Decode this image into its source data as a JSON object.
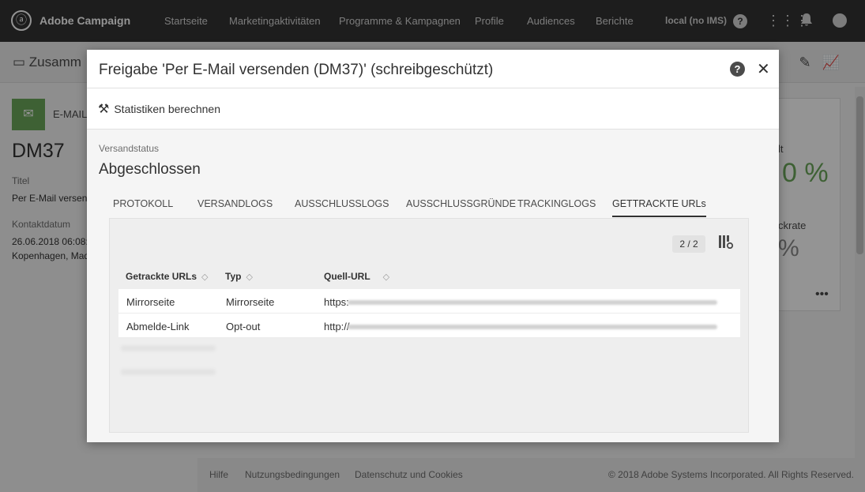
{
  "topbar": {
    "brand": "Adobe Campaign",
    "nav": [
      "Startseite",
      "Marketingaktivitäten",
      "Programme & Kampagnen",
      "Profile",
      "Audiences",
      "Berichte"
    ],
    "instance": "local (no IMS)",
    "help_glyph": "?"
  },
  "background": {
    "page_title": "Zusamm",
    "channel_label": "E-MAIL",
    "delivery_code": "DM37",
    "title_label": "Titel",
    "title_value": "Per E-Mail versend",
    "contact_label": "Kontaktdatum",
    "contact_date": "26.06.2018 06:08:5",
    "contact_place": "Kopenhagen, Mad",
    "card_label_1": "lt",
    "card_pct_1": "0 %",
    "card_label_2": "ckrate",
    "card_pct_2": "%",
    "card_more": "•••",
    "footer_links": [
      "Hilfe",
      "Nutzungsbedingungen",
      "Datenschutz und Cookies"
    ],
    "copyright": "© 2018 Adobe Systems Incorporated. All Rights Reserved."
  },
  "modal": {
    "title": "Freigabe 'Per E-Mail versenden (DM37)' (schreibgeschützt)",
    "help_glyph": "?",
    "close_glyph": "✕",
    "toolbar_action": "Statistiken berechnen",
    "status_label": "Versandstatus",
    "status_value": "Abgeschlossen",
    "tabs": [
      "PROTOKOLL",
      "VERSANDLOGS",
      "AUSSCHLUSSLOGS",
      "AUSSCHLUSSGRÜNDE",
      "TRACKINGLOGS",
      "GETTRACKTE URLs"
    ],
    "active_tab": "GETTRACKTE URLs",
    "pager": "2 / 2",
    "columns": [
      "Getrackte URLs",
      "Typ",
      "Quell-URL"
    ],
    "rows": [
      {
        "name": "Mirrorseite",
        "type": "Mirrorseite",
        "url_prefix": "https:"
      },
      {
        "name": "Abmelde-Link",
        "type": "Opt-out",
        "url_prefix": "http://"
      }
    ]
  },
  "colors": {
    "topbar": "#323232",
    "accent_green": "#6ba75b",
    "overlay": "rgba(0,0,0,0.42)"
  }
}
